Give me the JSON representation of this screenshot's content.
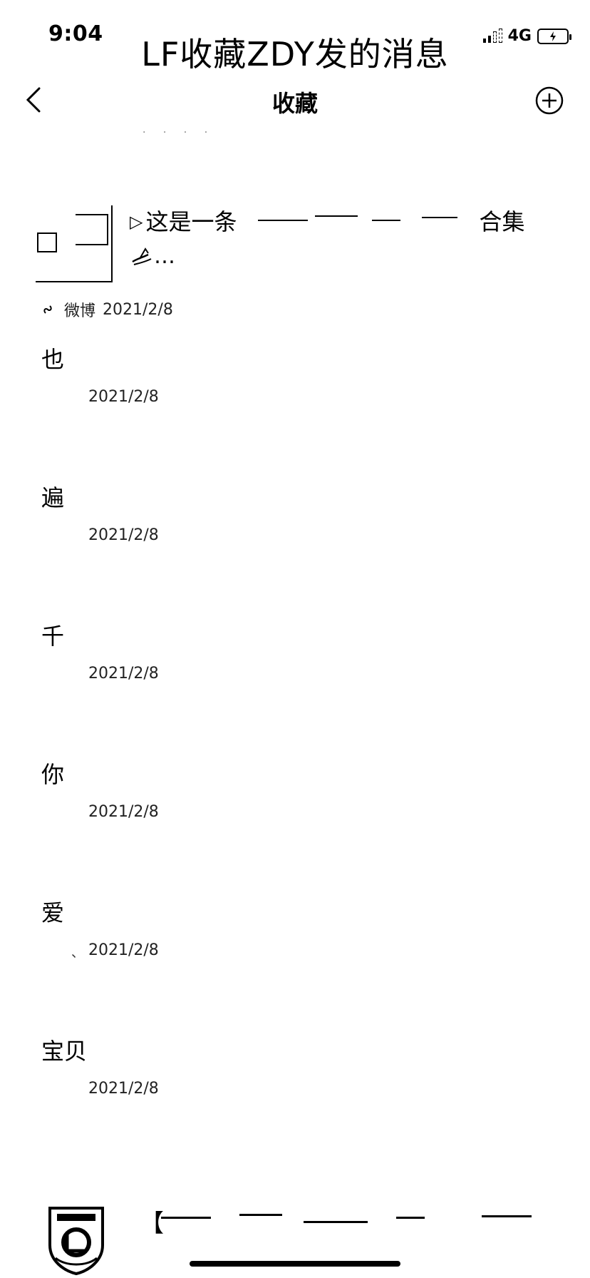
{
  "status_bar": {
    "time": "9:04",
    "network": "4G"
  },
  "overlay_caption": "LF收藏ZDY发的消息",
  "nav": {
    "title": "收藏"
  },
  "link_card": {
    "title_prefix": "这是一条",
    "title_suffix": "合集",
    "second_line": "…",
    "source": "微博",
    "date": "2021/2/8"
  },
  "items": [
    {
      "text": "也",
      "date": "2021/2/8"
    },
    {
      "text": "遍",
      "date": "2021/2/8"
    },
    {
      "text": "千",
      "date": "2021/2/8"
    },
    {
      "text": "你",
      "date": "2021/2/8"
    },
    {
      "text": "爱",
      "date": "2021/2/8",
      "mark": "、"
    },
    {
      "text": "宝贝",
      "date": "2021/2/8"
    }
  ],
  "bottom_item": {
    "bracket": "【"
  },
  "icons": {
    "back": "chevron-left-icon",
    "add": "plus-circle-icon",
    "source": "link-icon",
    "logo": "university-logo"
  }
}
